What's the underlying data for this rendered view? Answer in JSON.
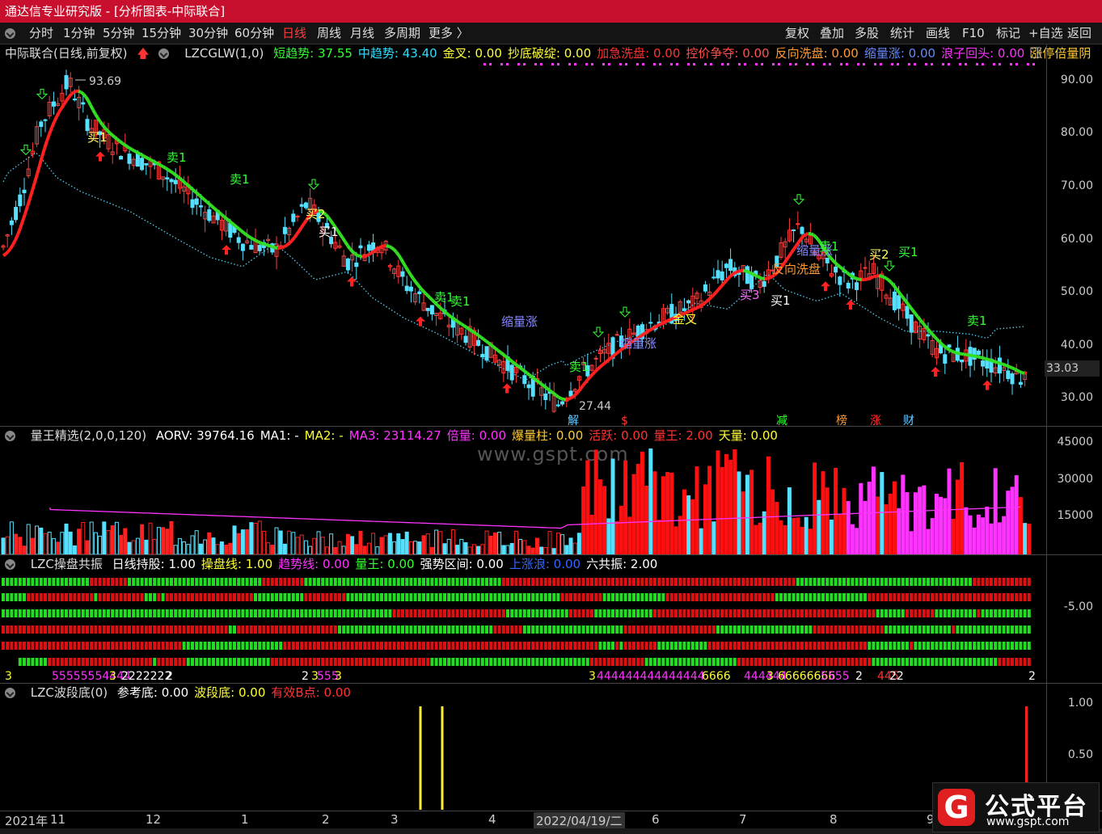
{
  "window": {
    "title": "通达信专业研究版 - [分析图表-中际联合]"
  },
  "toolbar": {
    "periods": [
      "分时",
      "1分钟",
      "5分钟",
      "15分钟",
      "30分钟",
      "60分钟",
      "日线",
      "周线",
      "月线",
      "多周期",
      "更多 〉"
    ],
    "active_period": "日线",
    "right_buttons": [
      "复权",
      "叠加",
      "多股",
      "统计",
      "画线",
      "F10",
      "标记",
      "+自选",
      "返回"
    ]
  },
  "main_panel": {
    "stock": "中际联合(日线,前复权)",
    "indicator": "LZCGLW(1,0)",
    "fields": [
      {
        "label": "短趋势: 37.55",
        "color": "#33ff33"
      },
      {
        "label": "中趋势: 43.40",
        "color": "#33ddff"
      },
      {
        "label": "金叉: 0.00",
        "color": "#ffff33"
      },
      {
        "label": "抄底破绽: 0.00",
        "color": "#ffff33"
      },
      {
        "label": "加急洗盘: 0.00",
        "color": "#ff3333"
      },
      {
        "label": "控价争夺: 0.00",
        "color": "#ff5050"
      },
      {
        "label": "反向洗盘: 0.00",
        "color": "#ff9933"
      },
      {
        "label": "缩量涨: 0.00",
        "color": "#6688ff"
      },
      {
        "label": "浪子回头: 0.00",
        "color": "#ff33ff"
      },
      {
        "label": "涨停倍量阴",
        "color": "#ffcc33"
      }
    ],
    "y_ticks": [
      "90.00",
      "80.00",
      "70.00",
      "60.00",
      "50.00",
      "40.00",
      "30.00"
    ],
    "y_range": [
      25,
      97
    ],
    "current_price": "33.03",
    "high_label": "93.69",
    "low_label": "27.44",
    "annotations": [
      {
        "text": "买1",
        "color": "#ffff66"
      },
      {
        "text": "卖1",
        "color": "#33ff33"
      },
      {
        "text": "卖1",
        "color": "#33ff33"
      },
      {
        "text": "买2",
        "color": "#ffff66"
      },
      {
        "text": "买1",
        "color": "#ffffff"
      },
      {
        "text": "卖1",
        "color": "#33ff33"
      },
      {
        "text": "缩量涨",
        "color": "#8888ff"
      },
      {
        "text": "卖1",
        "color": "#33ff33"
      },
      {
        "text": "卖1",
        "color": "#33ff33"
      },
      {
        "text": "缩量涨",
        "color": "#8888ff"
      },
      {
        "text": "金叉",
        "color": "#ffff33"
      },
      {
        "text": "买3",
        "color": "#ff66ff"
      },
      {
        "text": "买1",
        "color": "#ffffff"
      },
      {
        "text": "缩量涨",
        "color": "#8888ff"
      },
      {
        "text": "反向洗盘",
        "color": "#ff9933"
      },
      {
        "text": "卖1",
        "color": "#33ff33"
      },
      {
        "text": "买2",
        "color": "#ffff66"
      },
      {
        "text": "买1",
        "color": "#33ff33"
      },
      {
        "text": "卖1",
        "color": "#33ff33"
      }
    ],
    "badges": [
      {
        "text": "解",
        "color": "#66ccff"
      },
      {
        "text": "$",
        "color": "#ff3333"
      },
      {
        "text": "减",
        "color": "#33ff33"
      },
      {
        "text": "榜",
        "color": "#ff9933"
      },
      {
        "text": "涨",
        "color": "#ff3333"
      },
      {
        "text": "财",
        "color": "#66ccff"
      }
    ]
  },
  "volume_panel": {
    "title": "量王精选(2,0,0,120)",
    "fields": [
      {
        "label": "AORV: 39764.16",
        "color": "#ffffff"
      },
      {
        "label": "MA1: -",
        "color": "#ffffff"
      },
      {
        "label": "MA2: -",
        "color": "#ffff33"
      },
      {
        "label": "MA3: 23114.27",
        "color": "#ff33ff"
      },
      {
        "label": "倍量: 0.00",
        "color": "#ff33ff"
      },
      {
        "label": "爆量柱: 0.00",
        "color": "#ffcc33"
      },
      {
        "label": "活跃: 0.00",
        "color": "#ff3333"
      },
      {
        "label": "量王: 2.00",
        "color": "#ff3333"
      },
      {
        "label": "天量: 0.00",
        "color": "#ffff33"
      }
    ],
    "y_ticks": [
      "45000",
      "30000",
      "15000"
    ],
    "y_range": [
      0,
      52000
    ]
  },
  "resonance_panel": {
    "title": "LZC操盘共振",
    "fields": [
      {
        "label": "日线持股: 1.00",
        "color": "#ffffff"
      },
      {
        "label": "操盘线: 1.00",
        "color": "#ffff33"
      },
      {
        "label": "趋势线: 0.00",
        "color": "#ff33ff"
      },
      {
        "label": "量王: 0.00",
        "color": "#33ff33"
      },
      {
        "label": "强势区间: 0.00",
        "color": "#ffffff"
      },
      {
        "label": "上涨浪: 0.00",
        "color": "#3366ff"
      },
      {
        "label": "六共振: 2.00",
        "color": "#ffffff"
      }
    ],
    "y_ticks": [
      "-5.00"
    ]
  },
  "wave_panel": {
    "title": "LZC波段底(0)",
    "fields": [
      {
        "label": "参考底: 0.00",
        "color": "#ffffff"
      },
      {
        "label": "波段底: 0.00",
        "color": "#ffff33"
      },
      {
        "label": "有效B点: 0.00",
        "color": "#ff3333"
      }
    ],
    "y_ticks": [
      "1.00",
      "0.50"
    ]
  },
  "date_axis": [
    "2021年",
    "11",
    "12",
    "1",
    "2",
    "3",
    "4",
    "2022/04/19/二",
    "6",
    "7",
    "8",
    "9"
  ],
  "watermark": "www.gspt.com",
  "logo": {
    "name": "公式平台",
    "url": "www.gspt.com",
    "letter": "G"
  }
}
